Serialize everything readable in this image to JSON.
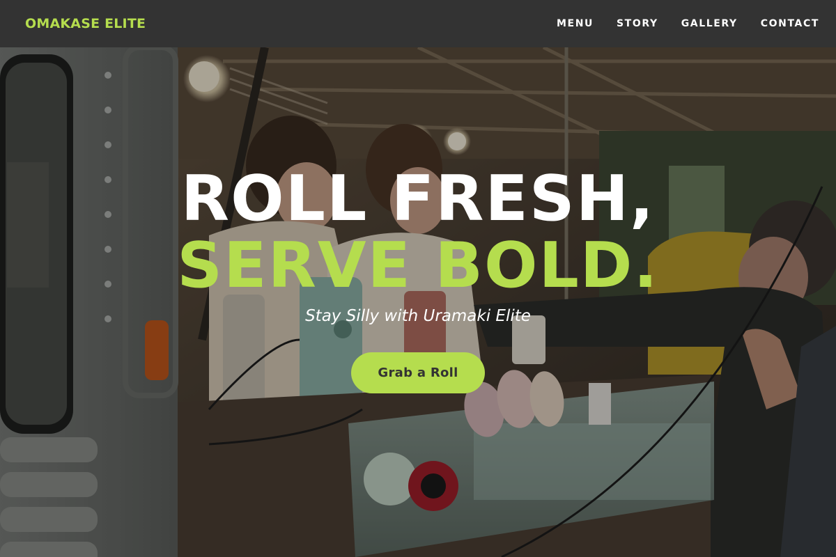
{
  "nav": {
    "brand": "OMAKASE ELITE",
    "links": [
      {
        "label": "MENU"
      },
      {
        "label": "STORY"
      },
      {
        "label": "GALLERY"
      },
      {
        "label": "CONTACT"
      }
    ]
  },
  "hero": {
    "headline_line1": "ROLL FRESH,",
    "headline_line2": "SERVE BOLD.",
    "tagline": "Stay Silly with Uramaki Elite",
    "cta_label": "Grab a Roll"
  },
  "colors": {
    "accent": "#b5dd4e",
    "nav_bg": "#333333",
    "text_light": "#ffffff",
    "button_text": "#333333"
  }
}
